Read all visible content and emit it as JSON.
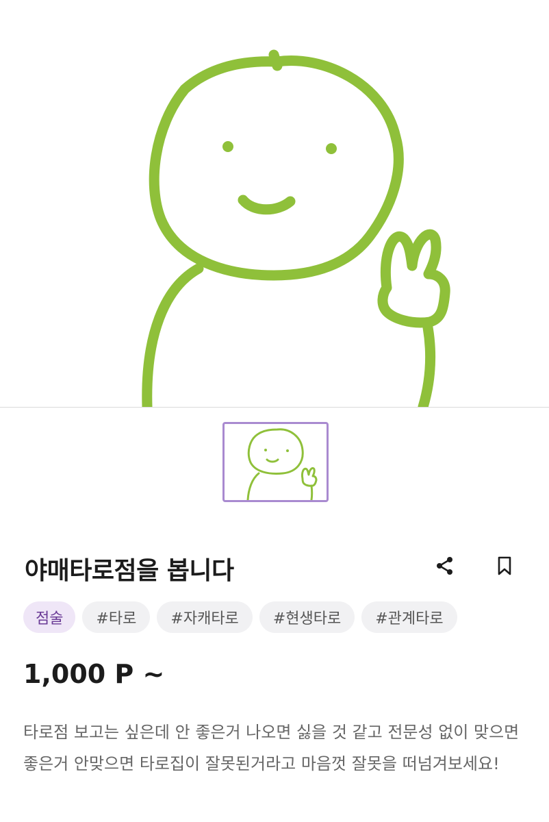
{
  "product": {
    "title": "야매타로점을 봅니다",
    "price": "1,000 P ~",
    "description": "타로점 보고는 싶은데 안 좋은거 나오면 싫을 것 같고 전문성 없이 맞으면 좋은거 안맞으면 타로집이 잘못된거라고 마음껏 잘못을 떠넘겨보세요!"
  },
  "tags": {
    "category": "점술",
    "items": [
      "#타로",
      "#자캐타로",
      "#현생타로",
      "#관계타로"
    ]
  },
  "icons": {
    "share": "share-icon",
    "bookmark": "bookmark-icon"
  },
  "colors": {
    "line_art": "#8fc03a",
    "thumb_border": "#a98ad0",
    "category_bg": "#efe6f7",
    "category_text": "#6a3a96",
    "tag_bg": "#f1f1f3"
  }
}
